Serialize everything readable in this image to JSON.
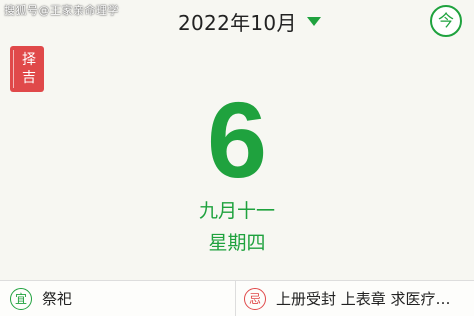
{
  "watermark": "搜狐号@王家亲命理学",
  "header": {
    "month_label": "2022年10月",
    "today_label": "今"
  },
  "zeji": [
    "择",
    "吉"
  ],
  "day": {
    "number": "6",
    "lunar": "九月十一",
    "weekday": "星期四"
  },
  "footer": {
    "yi_badge": "宜",
    "yi_text": "祭祀",
    "ji_badge": "忌",
    "ji_text": "上册受封 上表章 求医疗…"
  },
  "colors": {
    "accent_green": "#1fa23e",
    "accent_red": "#e0494a"
  }
}
